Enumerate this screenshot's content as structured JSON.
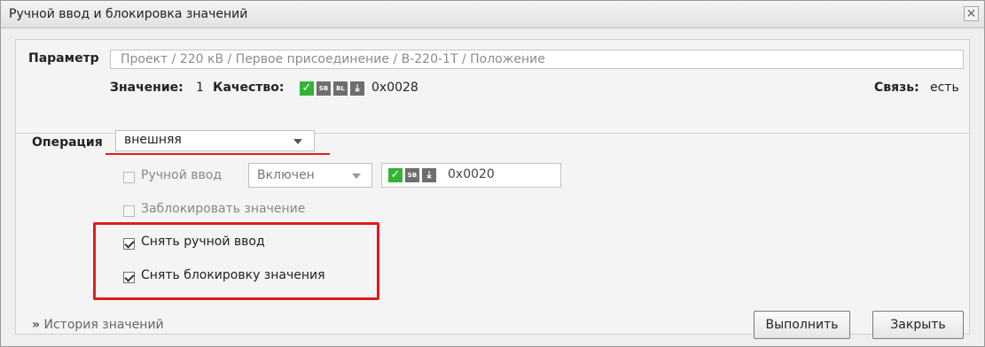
{
  "window": {
    "title": "Ручной ввод и блокировка значений",
    "close_glyph": "✕"
  },
  "parameter": {
    "label": "Параметр",
    "path": "Проект / 220 кВ / Первое присоединение / В-220-1Т / Положение"
  },
  "value_row": {
    "value_label": "Значение:",
    "value": "1",
    "quality_label": "Качество:",
    "quality_badges": [
      {
        "icon": "check-icon",
        "text": "✓"
      },
      {
        "icon": "sb-icon",
        "text": "SB"
      },
      {
        "icon": "bl-icon",
        "text": "BL"
      },
      {
        "icon": "arrow-down-icon",
        "text": "⤓"
      }
    ],
    "quality_code": "0x0028",
    "link_label": "Связь:",
    "link_value": "есть"
  },
  "operation": {
    "label": "Операция",
    "selected": "внешняя"
  },
  "manual_input": {
    "label": "Ручной ввод",
    "checked": false,
    "enabled": false,
    "state_selected": "Включен",
    "quality_badges": [
      {
        "icon": "check-icon",
        "text": "✓"
      },
      {
        "icon": "sb-icon",
        "text": "SB"
      },
      {
        "icon": "arrow-down-icon",
        "text": "⤓"
      }
    ],
    "quality_code": "0x0020"
  },
  "block_value": {
    "label": "Заблокировать значение",
    "checked": false,
    "enabled": false
  },
  "remove_manual": {
    "label": "Снять ручной ввод",
    "checked": true
  },
  "remove_block": {
    "label": "Снять блокировку значения",
    "checked": true
  },
  "footer": {
    "history_link": "История значений",
    "history_glyph": "»",
    "execute_button": "Выполнить",
    "close_button": "Закрыть"
  },
  "colors": {
    "highlight": "#e21b1b",
    "quality_ok": "#34b334",
    "quality_flag": "#6e6e6e"
  }
}
